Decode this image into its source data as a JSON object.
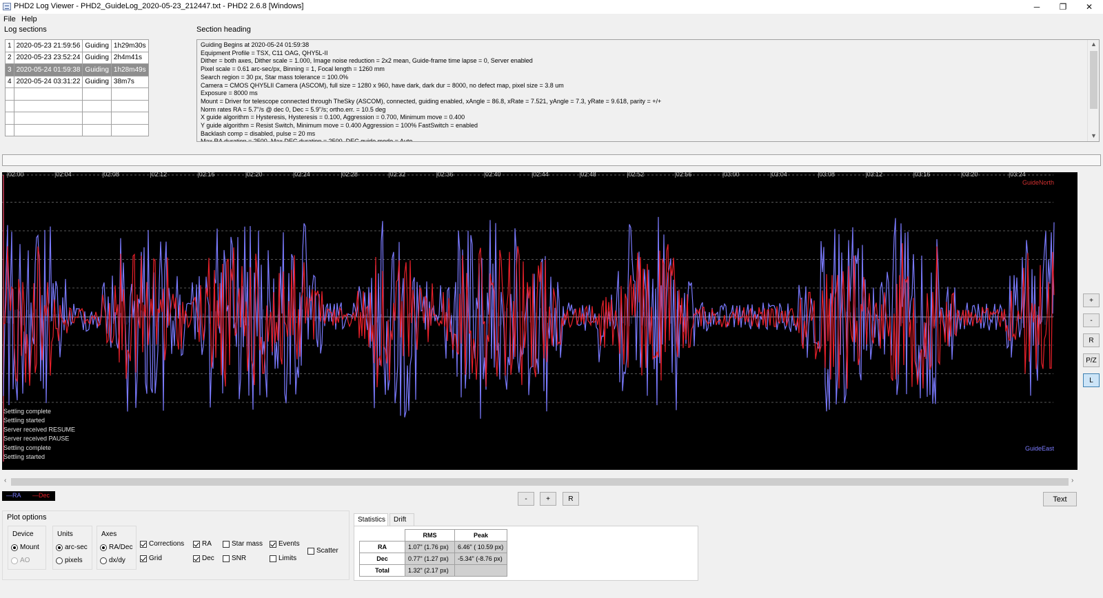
{
  "window": {
    "title": "PHD2 Log Viewer - PHD2_GuideLog_2020-05-23_212447.txt - PHD2 2.6.8 [Windows]",
    "minimize": "─",
    "restore": "❐",
    "close": "✕"
  },
  "menu": {
    "file": "File",
    "help": "Help"
  },
  "log_sections": {
    "label": "Log sections",
    "rows": [
      {
        "n": "1",
        "start": "2020-05-23 21:59:56",
        "type": "Guiding",
        "duration": "1h29m30s"
      },
      {
        "n": "2",
        "start": "2020-05-23 23:52:24",
        "type": "Guiding",
        "duration": "2h4m41s"
      },
      {
        "n": "3",
        "start": "2020-05-24 01:59:38",
        "type": "Guiding",
        "duration": "1h28m49s"
      },
      {
        "n": "4",
        "start": "2020-05-24 03:31:22",
        "type": "Guiding",
        "duration": "38m7s"
      }
    ],
    "selected_index": 2
  },
  "section_heading": {
    "label": "Section heading",
    "lines": [
      "Guiding Begins at 2020-05-24 01:59:38",
      "Equipment Profile = TSX, C11 OAG, QHY5L-II",
      "Dither = both axes, Dither scale = 1.000, Image noise reduction = 2x2 mean, Guide-frame time lapse = 0, Server enabled",
      "Pixel scale = 0.61 arc-sec/px, Binning = 1, Focal length = 1260 mm",
      "Search region = 30 px, Star mass tolerance = 100.0%",
      "Camera = CMOS QHY5LII Camera (ASCOM), full size = 1280 x 960, have dark, dark dur = 8000, no defect map, pixel size = 3.8 um",
      "Exposure = 8000 ms",
      "Mount = Driver for telescope connected through TheSky (ASCOM), connected, guiding enabled, xAngle = 86.8, xRate = 7.521, yAngle = 7.3, yRate = 9.618, parity = +/+",
      "Norm rates RA = 5.7\"/s @ dec 0, Dec = 5.9\"/s; ortho.err. = 10.5 deg",
      "X guide algorithm = Hysteresis, Hysteresis = 0.100, Aggression = 0.700, Minimum move = 0.400",
      "Y guide algorithm = Resist Switch, Minimum move = 0.400 Aggression = 100% FastSwitch = enabled",
      "Backlash comp = disabled, pulse = 20 ms",
      "Max RA duration = 2500, Max DEC duration = 2500, DEC guide mode = Auto"
    ]
  },
  "plot": {
    "time_ticks": [
      "02:00",
      "02:04",
      "02:08",
      "02:12",
      "02:16",
      "02:20",
      "02:24",
      "02:28",
      "02:32",
      "02:36",
      "02:40",
      "02:44",
      "02:48",
      "02:52",
      "02:56",
      "03:00",
      "03:04",
      "03:08",
      "03:12",
      "03:16",
      "03:20",
      "03:24"
    ],
    "guide_north": "GuideNorth",
    "guide_east": "GuideEast",
    "events": [
      "Settling complete",
      "Settling started",
      "Server received RESUME",
      "Server received PAUSE",
      "Settling complete",
      "Settling started"
    ],
    "ra_color": "#7b7bff",
    "dec_color": "#e8202a"
  },
  "side_buttons": [
    "+",
    "-",
    "R",
    "P/Z",
    "L"
  ],
  "legend": {
    "ra": "—RA",
    "dec": "—Dec"
  },
  "zoom_buttons": [
    "-",
    "+",
    "R"
  ],
  "text_button": "Text",
  "plot_options": {
    "label": "Plot options",
    "device": {
      "label": "Device",
      "mount": "Mount",
      "ao": "AO"
    },
    "units": {
      "label": "Units",
      "arcsec": "arc-sec",
      "pixels": "pixels"
    },
    "axes": {
      "label": "Axes",
      "radec": "RA/Dec",
      "dxdy": "dx/dy"
    },
    "checks": {
      "corrections": "Corrections",
      "grid": "Grid",
      "ra": "RA",
      "dec": "Dec",
      "star_mass": "Star mass",
      "snr": "SNR",
      "events": "Events",
      "limits": "Limits",
      "scatter": "Scatter"
    }
  },
  "stats": {
    "tab_statistics": "Statistics",
    "tab_drift": "Drift",
    "headers": [
      "RMS",
      "Peak"
    ],
    "rows": [
      {
        "label": "RA",
        "rms": "1.07\" (1.76 px)",
        "peak": "6.46\" ( 10.59 px)"
      },
      {
        "label": "Dec",
        "rms": "0.77\" (1.27 px)",
        "peak": "-5.34\" (-8.76 px)"
      },
      {
        "label": "Total",
        "rms": "1.32\" (2.17 px)",
        "peak": ""
      }
    ]
  }
}
